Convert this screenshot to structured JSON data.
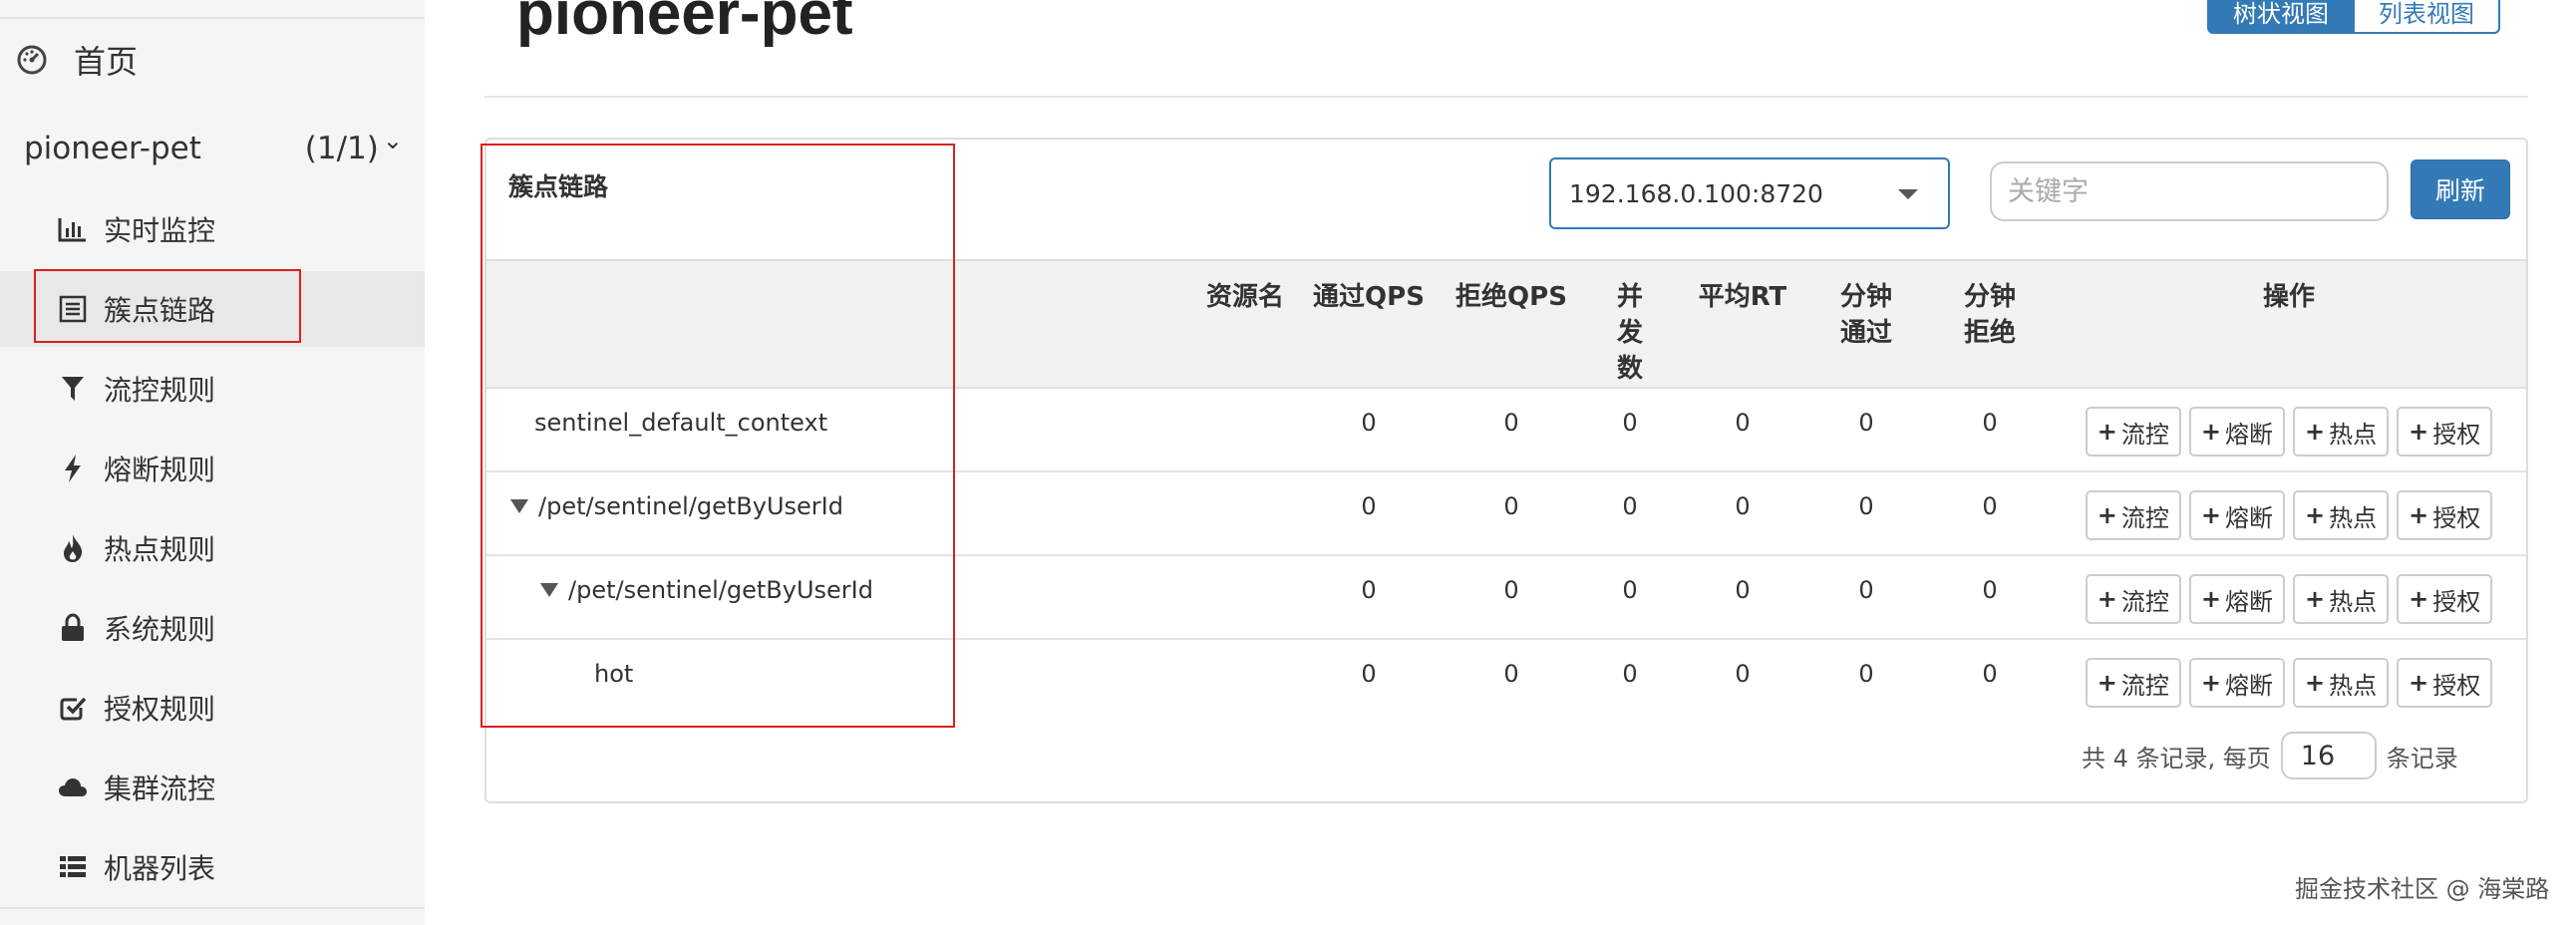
{
  "sidebar": {
    "home_label": "首页",
    "app_name": "pioneer-pet",
    "app_count": "(1/1)",
    "items": [
      {
        "label": "实时监控",
        "icon": "bar-chart-icon"
      },
      {
        "label": "簇点链路",
        "icon": "list-icon"
      },
      {
        "label": "流控规则",
        "icon": "filter-icon"
      },
      {
        "label": "熔断规则",
        "icon": "bolt-icon"
      },
      {
        "label": "热点规则",
        "icon": "fire-icon"
      },
      {
        "label": "系统规则",
        "icon": "lock-icon"
      },
      {
        "label": "授权规则",
        "icon": "check-square-icon"
      },
      {
        "label": "集群流控",
        "icon": "cloud-icon"
      },
      {
        "label": "机器列表",
        "icon": "list-ul-icon"
      }
    ]
  },
  "header": {
    "title": "pioneer-pet",
    "tree_view": "树状视图",
    "list_view": "列表视图"
  },
  "panel": {
    "title": "簇点链路",
    "machine": "192.168.0.100:8720",
    "search_placeholder": "关键字",
    "refresh": "刷新"
  },
  "table": {
    "headers": {
      "resource": "资源名",
      "pass_qps": "通过QPS",
      "block_qps": "拒绝QPS",
      "concurrency": "并发数",
      "avg_rt": "平均RT",
      "minute_pass": "分钟通过",
      "minute_block": "分钟拒绝",
      "ops": "操作"
    },
    "ops": {
      "flow": "流控",
      "degrade": "熔断",
      "hot": "热点",
      "auth": "授权"
    },
    "rows": [
      {
        "name": "sentinel_default_context",
        "pass_qps": "0",
        "block_qps": "0",
        "concurrency": "0",
        "avg_rt": "0",
        "minute_pass": "0",
        "minute_block": "0"
      },
      {
        "name": "/pet/sentinel/getByUserId",
        "pass_qps": "0",
        "block_qps": "0",
        "concurrency": "0",
        "avg_rt": "0",
        "minute_pass": "0",
        "minute_block": "0"
      },
      {
        "name": "/pet/sentinel/getByUserId",
        "pass_qps": "0",
        "block_qps": "0",
        "concurrency": "0",
        "avg_rt": "0",
        "minute_pass": "0",
        "minute_block": "0"
      },
      {
        "name": "hot",
        "pass_qps": "0",
        "block_qps": "0",
        "concurrency": "0",
        "avg_rt": "0",
        "minute_pass": "0",
        "minute_block": "0"
      }
    ]
  },
  "pager": {
    "prefix": "共 4 条记录, 每页",
    "page_size": "16",
    "suffix": "条记录"
  },
  "watermark": "掘金技术社区 @ 海棠路"
}
